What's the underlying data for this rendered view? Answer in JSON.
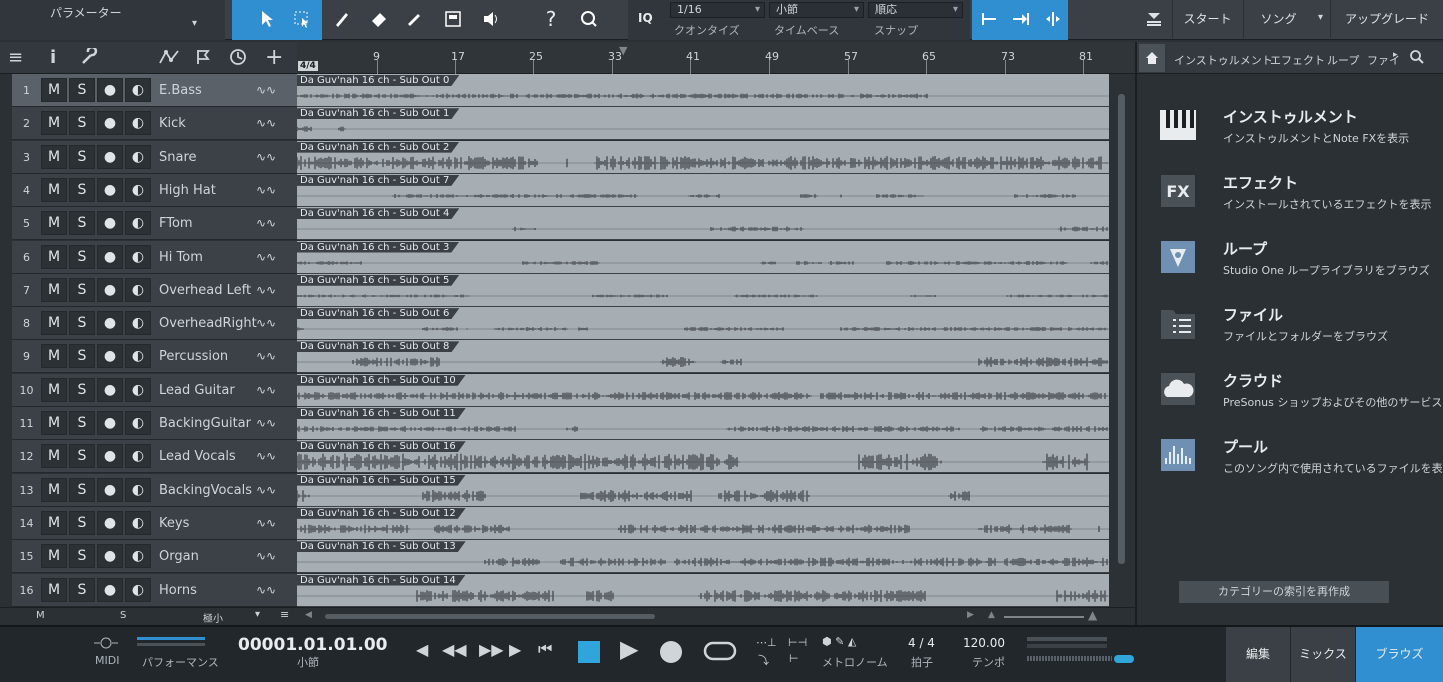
{
  "toolbar": {
    "parameter_label": "パラメーター",
    "quantize_value": "1/16",
    "quantize_label": "クオンタイズ",
    "timebase_value": "小節",
    "timebase_label": "タイムベース",
    "snap_value": "順応",
    "snap_label": "スナップ",
    "iq_label": "IQ",
    "start_label": "スタート",
    "song_label": "ソング",
    "upgrade_label": "アップグレード"
  },
  "ruler": {
    "signature": "4/4",
    "ticks": [
      "9",
      "17",
      "25",
      "33",
      "41",
      "49",
      "57",
      "65",
      "73",
      "81"
    ]
  },
  "tracks": [
    {
      "num": "1",
      "name": "E.Bass",
      "clip": "Da Guv'nah 16 ch - Sub Out 0"
    },
    {
      "num": "2",
      "name": "Kick",
      "clip": "Da Guv'nah 16 ch - Sub Out 1"
    },
    {
      "num": "3",
      "name": "Snare",
      "clip": "Da Guv'nah 16 ch - Sub Out 2"
    },
    {
      "num": "4",
      "name": "High Hat",
      "clip": "Da Guv'nah 16 ch - Sub Out 7"
    },
    {
      "num": "5",
      "name": "FTom",
      "clip": "Da Guv'nah 16 ch - Sub Out 4"
    },
    {
      "num": "6",
      "name": "Hi Tom",
      "clip": "Da Guv'nah 16 ch - Sub Out 3"
    },
    {
      "num": "7",
      "name": "Overhead Left",
      "clip": "Da Guv'nah 16 ch - Sub Out 5"
    },
    {
      "num": "8",
      "name": "OverheadRight",
      "clip": "Da Guv'nah 16 ch - Sub Out 6"
    },
    {
      "num": "9",
      "name": "Percussion",
      "clip": "Da Guv'nah 16 ch - Sub Out 8"
    },
    {
      "num": "10",
      "name": "Lead Guitar",
      "clip": "Da Guv'nah 16 ch - Sub Out 10"
    },
    {
      "num": "11",
      "name": "BackingGuitar",
      "clip": "Da Guv'nah 16 ch - Sub Out 11"
    },
    {
      "num": "12",
      "name": "Lead Vocals",
      "clip": "Da Guv'nah 16 ch - Sub Out 16"
    },
    {
      "num": "13",
      "name": "BackingVocals",
      "clip": "Da Guv'nah 16 ch - Sub Out 15"
    },
    {
      "num": "14",
      "name": "Keys",
      "clip": "Da Guv'nah 16 ch - Sub Out 12"
    },
    {
      "num": "15",
      "name": "Organ",
      "clip": "Da Guv'nah 16 ch - Sub Out 13"
    },
    {
      "num": "16",
      "name": "Horns",
      "clip": "Da Guv'nah 16 ch - Sub Out 14"
    }
  ],
  "track_buttons": {
    "mute": "M",
    "solo": "S"
  },
  "arrange_bottom": {
    "m": "M",
    "s": "S",
    "size": "極小"
  },
  "browser": {
    "tabs": [
      "インストゥルメント",
      "エフェクト",
      "ループ",
      "ファイ"
    ],
    "items": [
      {
        "title": "インストゥルメント",
        "desc": "インストゥルメントとNote FXを表示",
        "icon": "piano-icon"
      },
      {
        "title": "エフェクト",
        "desc": "インストールされているエフェクトを表示",
        "icon": "fx-icon"
      },
      {
        "title": "ループ",
        "desc": "Studio One ループライブラリをブラウズ",
        "icon": "loop-icon"
      },
      {
        "title": "ファイル",
        "desc": "ファイルとフォルダーをブラウズ",
        "icon": "file-icon"
      },
      {
        "title": "クラウド",
        "desc": "PreSonus ショップおよびその他のサービス",
        "icon": "cloud-icon"
      },
      {
        "title": "プール",
        "desc": "このソング内で使用されているファイルを表",
        "icon": "pool-icon"
      }
    ],
    "reindex_label": "カテゴリーの索引を再作成"
  },
  "transport": {
    "midi_label": "MIDI",
    "performance_label": "パフォーマンス",
    "position": "00001.01.01.00",
    "position_label": "小節",
    "metronome_label": "メトロノーム",
    "signature": "4 / 4",
    "signature_label": "拍子",
    "tempo": "120.00",
    "tempo_label": "テンポ",
    "edit_label": "編集",
    "mix_label": "ミックス",
    "browse_label": "ブラウズ"
  },
  "colors": {
    "accent": "#2f8fd0",
    "clip": "#a6adb3",
    "wave": "#3a4046"
  }
}
